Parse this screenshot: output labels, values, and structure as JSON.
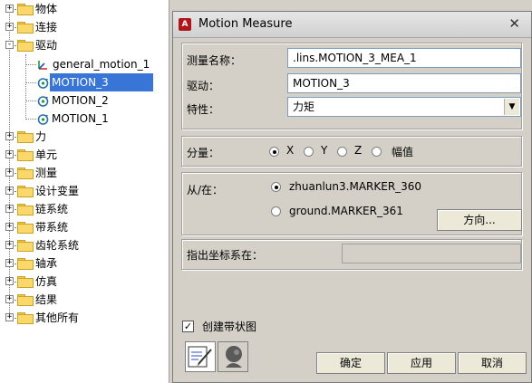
{
  "tree": {
    "items": [
      {
        "label": "物体",
        "expander": "+"
      },
      {
        "label": "连接",
        "expander": "+"
      },
      {
        "label": "驱动",
        "expander": "-"
      },
      {
        "label": "general_motion_1",
        "child": true,
        "icon": "general-motion-icon"
      },
      {
        "label": "MOTION_3",
        "child": true,
        "icon": "motion-icon",
        "selected": true
      },
      {
        "label": "MOTION_2",
        "child": true,
        "icon": "motion-icon"
      },
      {
        "label": "MOTION_1",
        "child": true,
        "icon": "motion-icon"
      },
      {
        "label": "力",
        "expander": "+"
      },
      {
        "label": "单元",
        "expander": "+"
      },
      {
        "label": "测量",
        "expander": "+"
      },
      {
        "label": "设计变量",
        "expander": "+"
      },
      {
        "label": "链系统",
        "expander": "+"
      },
      {
        "label": "带系统",
        "expander": "+"
      },
      {
        "label": "齿轮系统",
        "expander": "+"
      },
      {
        "label": "轴承",
        "expander": "+"
      },
      {
        "label": "仿真",
        "expander": "+"
      },
      {
        "label": "结果",
        "expander": "+"
      },
      {
        "label": "其他所有",
        "expander": "+"
      }
    ]
  },
  "dialog": {
    "app_icon": "A",
    "title": "Motion Measure",
    "close": "✕",
    "measure_name_label": "测量名称：",
    "measure_name_value": ".lins.MOTION_3_MEA_1",
    "motion_label": "驱动：",
    "motion_value": "MOTION_3",
    "characteristic_label": "特性：",
    "characteristic_value": "力矩",
    "component_label": "分量：",
    "components": [
      "X",
      "Y",
      "Z",
      "幅值"
    ],
    "selected_component": "X",
    "from_at_label": "从/在：",
    "marker_options": [
      "zhuanlun3.MARKER_360",
      "ground.MARKER_361"
    ],
    "selected_marker": "zhuanlun3.MARKER_360",
    "direction_button": "方向...",
    "coord_system_label": "指出坐标系在：",
    "coord_system_value": "",
    "create_strip_chart_label": "创建带状图",
    "create_strip_chart_checked": true,
    "ok_button": "确定",
    "apply_button": "应用",
    "cancel_button": "取消"
  },
  "colors": {
    "selection": "#3875d7",
    "folder": "#fbd86a",
    "dialog_bg": "#d4d0c8",
    "app_icon": "#b3141b"
  }
}
